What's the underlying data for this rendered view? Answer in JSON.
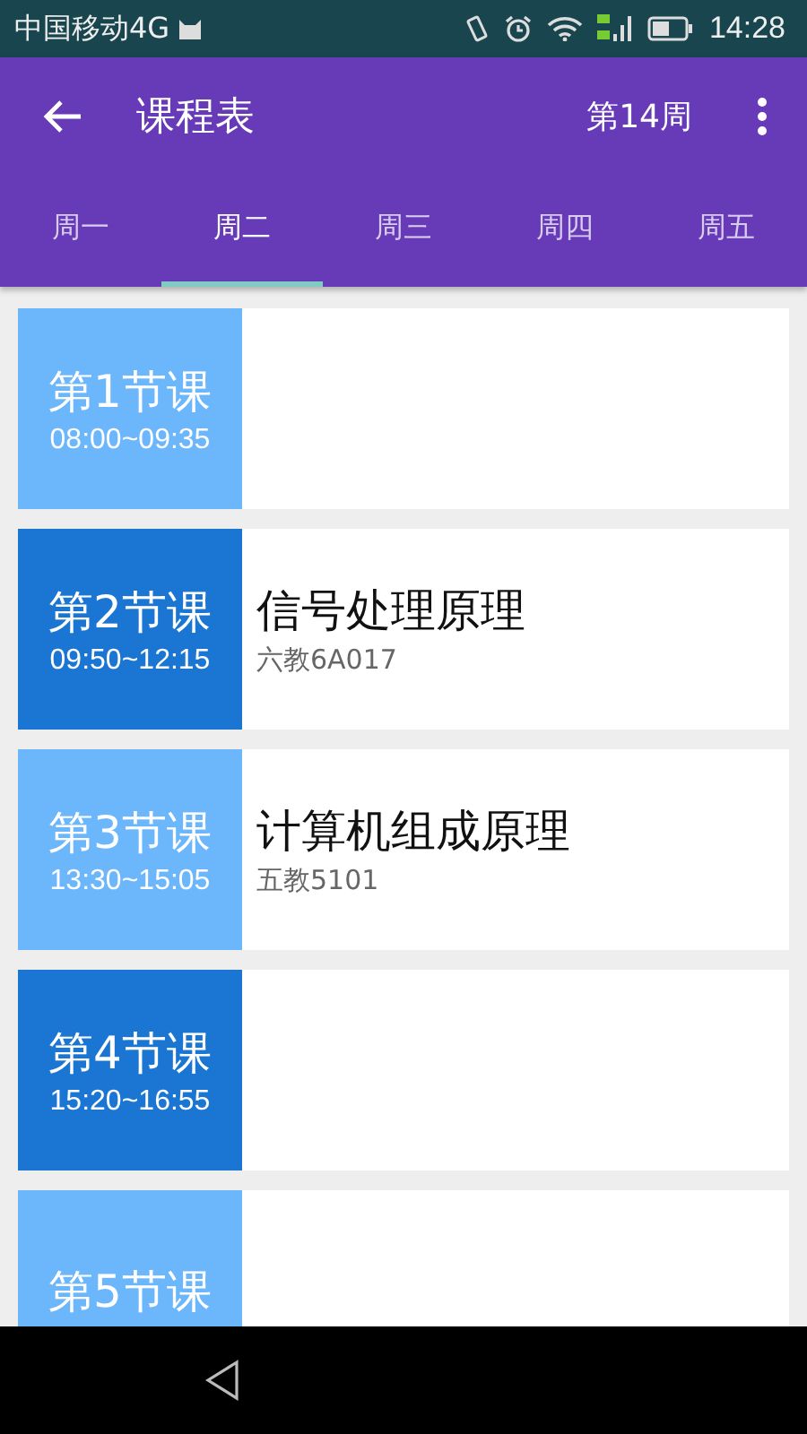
{
  "status_bar": {
    "carrier": "中国移动4G",
    "time": "14:28"
  },
  "toolbar": {
    "title": "课程表",
    "week": "第14周"
  },
  "tabs": [
    {
      "label": "周一",
      "selected": false
    },
    {
      "label": "周二",
      "selected": true
    },
    {
      "label": "周三",
      "selected": false
    },
    {
      "label": "周四",
      "selected": false
    },
    {
      "label": "周五",
      "selected": false
    }
  ],
  "periods": [
    {
      "name": "第1节课",
      "time": "08:00~09:35",
      "color": "#6cb6fc"
    },
    {
      "name": "第2节课",
      "time": "09:50~12:15",
      "color": "#1a76d2",
      "course": "信号处理原理",
      "room": "六教6A017"
    },
    {
      "name": "第3节课",
      "time": "13:30~15:05",
      "color": "#6cb6fc",
      "course": "计算机组成原理",
      "room": "五教5101"
    },
    {
      "name": "第4节课",
      "time": "15:20~16:55",
      "color": "#1a76d2"
    },
    {
      "name": "第5节课",
      "color": "#6cb6fc"
    }
  ]
}
